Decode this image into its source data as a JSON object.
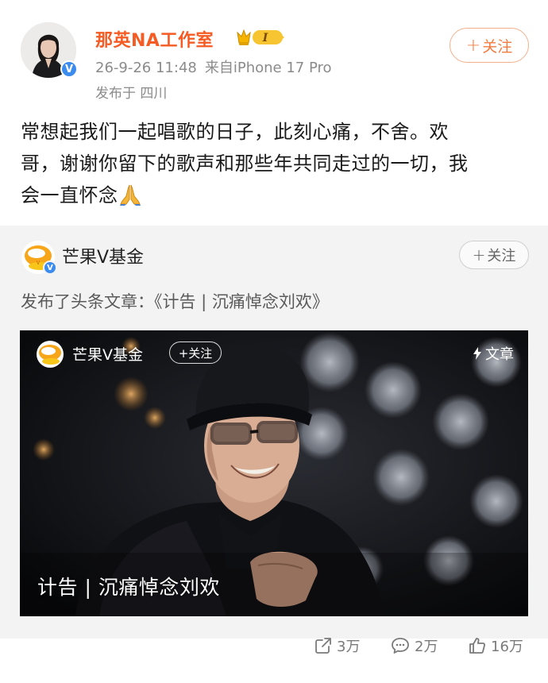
{
  "post": {
    "author": "那英NA工作室",
    "vip_badge_text": "I",
    "timestamp": "26-9-26 11:48",
    "source": "来自iPhone 17 Pro",
    "location": "发布于 四川",
    "follow_label": "关注",
    "text_lines": [
      "常想起我们一起唱歌的日子，此刻心痛，不舍。欢",
      "哥，谢谢你留下的歌声和那些年共同走过的一切，我",
      "会一直怀念"
    ],
    "icons": {
      "avatar": "avatar-image",
      "verified": "verified-icon",
      "vip": "crown-vip-icon",
      "emoji": "praying-hands-icon"
    }
  },
  "repost": {
    "author": "芒果V基金",
    "follow_label": "关注",
    "description": "发布了头条文章：《计告 | 沉痛悼念刘欢》",
    "article": {
      "author": "芒果V基金",
      "follow_label": "+关注",
      "type_label": "文章",
      "title": "计告 | 沉痛悼念刘欢"
    }
  },
  "stats": {
    "reposts": "3万",
    "comments": "2万",
    "likes": "16万"
  },
  "colors": {
    "username": "#f55b23",
    "follow_border": "#f3b08c",
    "verified": "#3c8cf0",
    "repost_bg": "#f3f3f3"
  }
}
